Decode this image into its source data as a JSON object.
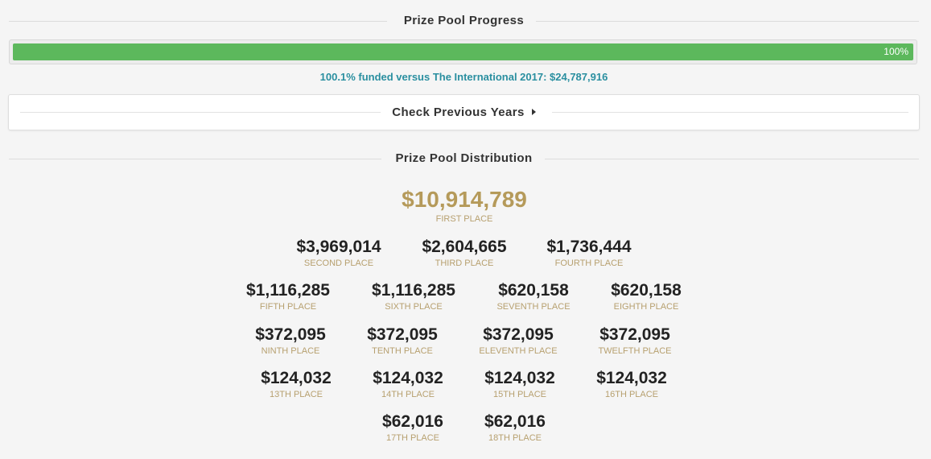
{
  "progress": {
    "heading": "Prize Pool Progress",
    "bar_label": "100%",
    "bar_fill_fraction": 1.0,
    "bar_color": "#5cb85c",
    "funded_note": "100.1% funded versus The International 2017: $24,787,916",
    "note_color": "#2a8fa0"
  },
  "previous_years": {
    "label": "Check Previous Years"
  },
  "distribution": {
    "heading": "Prize Pool Distribution",
    "accent_color": "#b59a5a",
    "prizes": [
      {
        "amount": "$10,914,789",
        "place": "FIRST PLACE"
      },
      {
        "amount": "$3,969,014",
        "place": "SECOND PLACE"
      },
      {
        "amount": "$2,604,665",
        "place": "THIRD PLACE"
      },
      {
        "amount": "$1,736,444",
        "place": "FOURTH PLACE"
      },
      {
        "amount": "$1,116,285",
        "place": "FIFTH PLACE"
      },
      {
        "amount": "$1,116,285",
        "place": "SIXTH PLACE"
      },
      {
        "amount": "$620,158",
        "place": "SEVENTH PLACE"
      },
      {
        "amount": "$620,158",
        "place": "EIGHTH PLACE"
      },
      {
        "amount": "$372,095",
        "place": "NINTH PLACE"
      },
      {
        "amount": "$372,095",
        "place": "TENTH PLACE"
      },
      {
        "amount": "$372,095",
        "place": "ELEVENTH PLACE"
      },
      {
        "amount": "$372,095",
        "place": "TWELFTH PLACE"
      },
      {
        "amount": "$124,032",
        "place": "13TH PLACE"
      },
      {
        "amount": "$124,032",
        "place": "14TH PLACE"
      },
      {
        "amount": "$124,032",
        "place": "15TH PLACE"
      },
      {
        "amount": "$124,032",
        "place": "16TH PLACE"
      },
      {
        "amount": "$62,016",
        "place": "17TH PLACE"
      },
      {
        "amount": "$62,016",
        "place": "18TH PLACE"
      }
    ]
  }
}
